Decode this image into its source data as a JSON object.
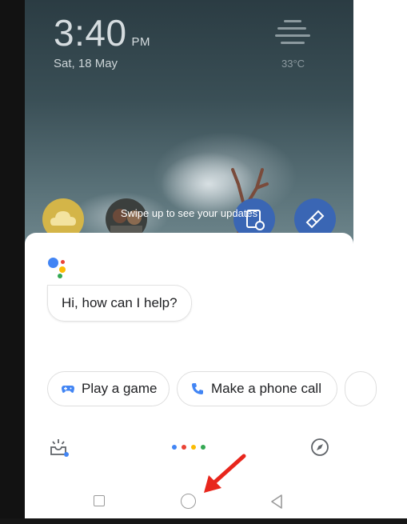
{
  "lock_screen": {
    "time": "3:40",
    "ampm": "PM",
    "date": "Sat, 18 May",
    "temperature": "33°C",
    "swipe_hint": "Swipe up to see your updates"
  },
  "assistant": {
    "greeting": "Hi, how can I help?",
    "suggestions": [
      {
        "label": "Play a game",
        "icon": "gamepad-icon"
      },
      {
        "label": "Make a phone call",
        "icon": "phone-icon"
      }
    ],
    "colors": {
      "blue": "#4285F4",
      "red": "#EA4335",
      "yellow": "#FBBC05",
      "green": "#34A853"
    }
  },
  "nav_bar": {
    "buttons": [
      "recents-icon",
      "home-icon",
      "back-icon"
    ]
  },
  "annotation": {
    "arrow_color": "#E8261C"
  }
}
